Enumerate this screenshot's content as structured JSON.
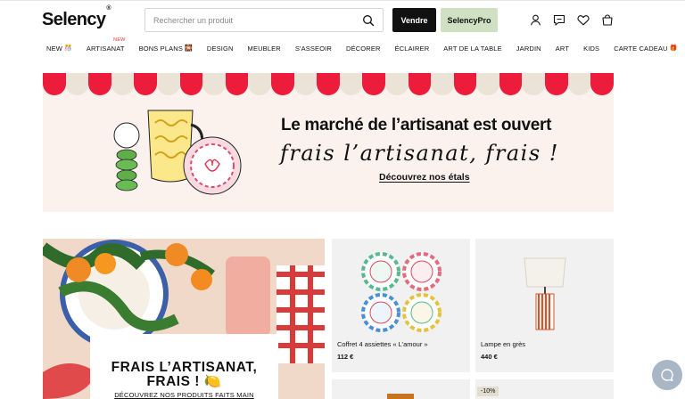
{
  "header": {
    "logo": "Selency",
    "logo_mark": "®",
    "search_placeholder": "Rechercher un produit",
    "sell_label": "Vendre",
    "pro_label": "SelencyPro"
  },
  "nav": {
    "items": [
      {
        "label": "NEW",
        "icon": "🎊"
      },
      {
        "label": "ARTISANAT",
        "badge": "NEW"
      },
      {
        "label": "BONS PLANS",
        "icon": "🎇"
      },
      {
        "label": "DESIGN"
      },
      {
        "label": "MEUBLER"
      },
      {
        "label": "S'ASSEOIR"
      },
      {
        "label": "DÉCORER"
      },
      {
        "label": "ÉCLAIRER"
      },
      {
        "label": "ART DE LA TABLE"
      },
      {
        "label": "JARDIN"
      },
      {
        "label": "ART"
      },
      {
        "label": "KIDS"
      },
      {
        "label": "CARTE CADEAU",
        "icon": "🎁"
      }
    ]
  },
  "banner": {
    "title": "Le marché de l’artisanat est ouvert",
    "script": "frais l’artisanat, frais !",
    "link": "Découvrez nos étals",
    "colors": {
      "awning_red": "#ee1c3b",
      "awning_cream": "#eae3d6",
      "background": "#fbf1ed"
    }
  },
  "promo": {
    "title_line1": "FRAIS L’ARTISANAT,",
    "title_line2": "FRAIS ! 🍋",
    "link": "DÉCOUVREZ NOS PRODUITS FAITS MAIN"
  },
  "products": [
    {
      "name": "Coffret 4 assiettes « L’amour »",
      "price": "112 €"
    },
    {
      "name": "Lampe en grès",
      "price": "440 €"
    },
    {},
    {
      "badge": "-10%"
    }
  ],
  "icons": {
    "search": "search-icon",
    "account": "user-icon",
    "messages": "chat-icon",
    "favorites": "heart-icon",
    "cart": "bag-icon",
    "help": "chat-bubble-icon"
  }
}
